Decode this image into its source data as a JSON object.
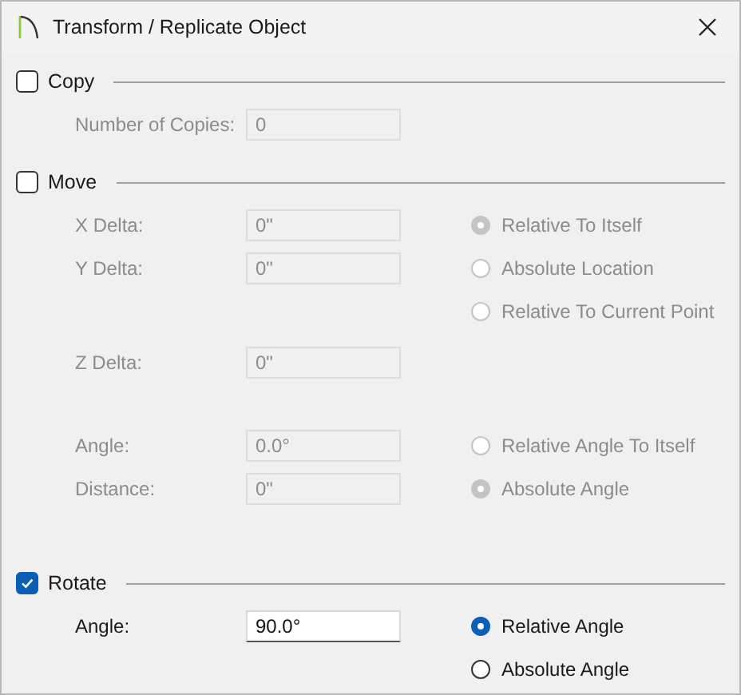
{
  "window": {
    "title": "Transform / Replicate Object"
  },
  "sections": [
    {
      "label": "Copy",
      "checked": false,
      "groups": [
        [
          {
            "field": {
              "label": "Number of Copies:",
              "value": "0"
            }
          }
        ]
      ]
    },
    {
      "label": "Move",
      "checked": false,
      "groups": [
        [
          {
            "field": {
              "label": "X Delta:",
              "value": "0\""
            },
            "radio": {
              "label": "Relative To Itself",
              "selected": true
            }
          },
          {
            "field": {
              "label": "Y Delta:",
              "value": "0\""
            },
            "radio": {
              "label": "Absolute Location",
              "selected": false
            }
          },
          {
            "radio": {
              "label": "Relative To Current Point",
              "selected": false
            }
          }
        ],
        [
          {
            "field": {
              "label": "Z Delta:",
              "value": "0\""
            }
          }
        ],
        [
          {
            "field": {
              "label": "Angle:",
              "value": "0.0°"
            },
            "radio": {
              "label": "Relative Angle To Itself",
              "selected": false
            }
          },
          {
            "field": {
              "label": "Distance:",
              "value": "0\""
            },
            "radio": {
              "label": "Absolute Angle",
              "selected": true
            }
          }
        ]
      ]
    },
    {
      "label": "Rotate",
      "checked": true,
      "groups": [
        [
          {
            "field": {
              "label": "Angle:",
              "value": "90.0°"
            },
            "radio": {
              "label": "Relative Angle",
              "selected": true
            }
          },
          {
            "radio": {
              "label": "Absolute Angle",
              "selected": false
            }
          }
        ]
      ]
    }
  ]
}
